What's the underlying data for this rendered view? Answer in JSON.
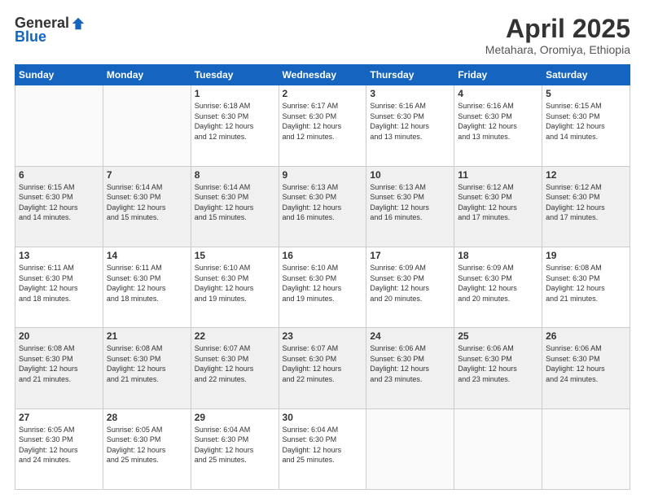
{
  "logo": {
    "general": "General",
    "blue": "Blue"
  },
  "header": {
    "month": "April 2025",
    "location": "Metahara, Oromiya, Ethiopia"
  },
  "days_of_week": [
    "Sunday",
    "Monday",
    "Tuesday",
    "Wednesday",
    "Thursday",
    "Friday",
    "Saturday"
  ],
  "weeks": [
    [
      {
        "day": "",
        "info": ""
      },
      {
        "day": "",
        "info": ""
      },
      {
        "day": "1",
        "info": "Sunrise: 6:18 AM\nSunset: 6:30 PM\nDaylight: 12 hours\nand 12 minutes."
      },
      {
        "day": "2",
        "info": "Sunrise: 6:17 AM\nSunset: 6:30 PM\nDaylight: 12 hours\nand 12 minutes."
      },
      {
        "day": "3",
        "info": "Sunrise: 6:16 AM\nSunset: 6:30 PM\nDaylight: 12 hours\nand 13 minutes."
      },
      {
        "day": "4",
        "info": "Sunrise: 6:16 AM\nSunset: 6:30 PM\nDaylight: 12 hours\nand 13 minutes."
      },
      {
        "day": "5",
        "info": "Sunrise: 6:15 AM\nSunset: 6:30 PM\nDaylight: 12 hours\nand 14 minutes."
      }
    ],
    [
      {
        "day": "6",
        "info": "Sunrise: 6:15 AM\nSunset: 6:30 PM\nDaylight: 12 hours\nand 14 minutes."
      },
      {
        "day": "7",
        "info": "Sunrise: 6:14 AM\nSunset: 6:30 PM\nDaylight: 12 hours\nand 15 minutes."
      },
      {
        "day": "8",
        "info": "Sunrise: 6:14 AM\nSunset: 6:30 PM\nDaylight: 12 hours\nand 15 minutes."
      },
      {
        "day": "9",
        "info": "Sunrise: 6:13 AM\nSunset: 6:30 PM\nDaylight: 12 hours\nand 16 minutes."
      },
      {
        "day": "10",
        "info": "Sunrise: 6:13 AM\nSunset: 6:30 PM\nDaylight: 12 hours\nand 16 minutes."
      },
      {
        "day": "11",
        "info": "Sunrise: 6:12 AM\nSunset: 6:30 PM\nDaylight: 12 hours\nand 17 minutes."
      },
      {
        "day": "12",
        "info": "Sunrise: 6:12 AM\nSunset: 6:30 PM\nDaylight: 12 hours\nand 17 minutes."
      }
    ],
    [
      {
        "day": "13",
        "info": "Sunrise: 6:11 AM\nSunset: 6:30 PM\nDaylight: 12 hours\nand 18 minutes."
      },
      {
        "day": "14",
        "info": "Sunrise: 6:11 AM\nSunset: 6:30 PM\nDaylight: 12 hours\nand 18 minutes."
      },
      {
        "day": "15",
        "info": "Sunrise: 6:10 AM\nSunset: 6:30 PM\nDaylight: 12 hours\nand 19 minutes."
      },
      {
        "day": "16",
        "info": "Sunrise: 6:10 AM\nSunset: 6:30 PM\nDaylight: 12 hours\nand 19 minutes."
      },
      {
        "day": "17",
        "info": "Sunrise: 6:09 AM\nSunset: 6:30 PM\nDaylight: 12 hours\nand 20 minutes."
      },
      {
        "day": "18",
        "info": "Sunrise: 6:09 AM\nSunset: 6:30 PM\nDaylight: 12 hours\nand 20 minutes."
      },
      {
        "day": "19",
        "info": "Sunrise: 6:08 AM\nSunset: 6:30 PM\nDaylight: 12 hours\nand 21 minutes."
      }
    ],
    [
      {
        "day": "20",
        "info": "Sunrise: 6:08 AM\nSunset: 6:30 PM\nDaylight: 12 hours\nand 21 minutes."
      },
      {
        "day": "21",
        "info": "Sunrise: 6:08 AM\nSunset: 6:30 PM\nDaylight: 12 hours\nand 21 minutes."
      },
      {
        "day": "22",
        "info": "Sunrise: 6:07 AM\nSunset: 6:30 PM\nDaylight: 12 hours\nand 22 minutes."
      },
      {
        "day": "23",
        "info": "Sunrise: 6:07 AM\nSunset: 6:30 PM\nDaylight: 12 hours\nand 22 minutes."
      },
      {
        "day": "24",
        "info": "Sunrise: 6:06 AM\nSunset: 6:30 PM\nDaylight: 12 hours\nand 23 minutes."
      },
      {
        "day": "25",
        "info": "Sunrise: 6:06 AM\nSunset: 6:30 PM\nDaylight: 12 hours\nand 23 minutes."
      },
      {
        "day": "26",
        "info": "Sunrise: 6:06 AM\nSunset: 6:30 PM\nDaylight: 12 hours\nand 24 minutes."
      }
    ],
    [
      {
        "day": "27",
        "info": "Sunrise: 6:05 AM\nSunset: 6:30 PM\nDaylight: 12 hours\nand 24 minutes."
      },
      {
        "day": "28",
        "info": "Sunrise: 6:05 AM\nSunset: 6:30 PM\nDaylight: 12 hours\nand 25 minutes."
      },
      {
        "day": "29",
        "info": "Sunrise: 6:04 AM\nSunset: 6:30 PM\nDaylight: 12 hours\nand 25 minutes."
      },
      {
        "day": "30",
        "info": "Sunrise: 6:04 AM\nSunset: 6:30 PM\nDaylight: 12 hours\nand 25 minutes."
      },
      {
        "day": "",
        "info": ""
      },
      {
        "day": "",
        "info": ""
      },
      {
        "day": "",
        "info": ""
      }
    ]
  ]
}
